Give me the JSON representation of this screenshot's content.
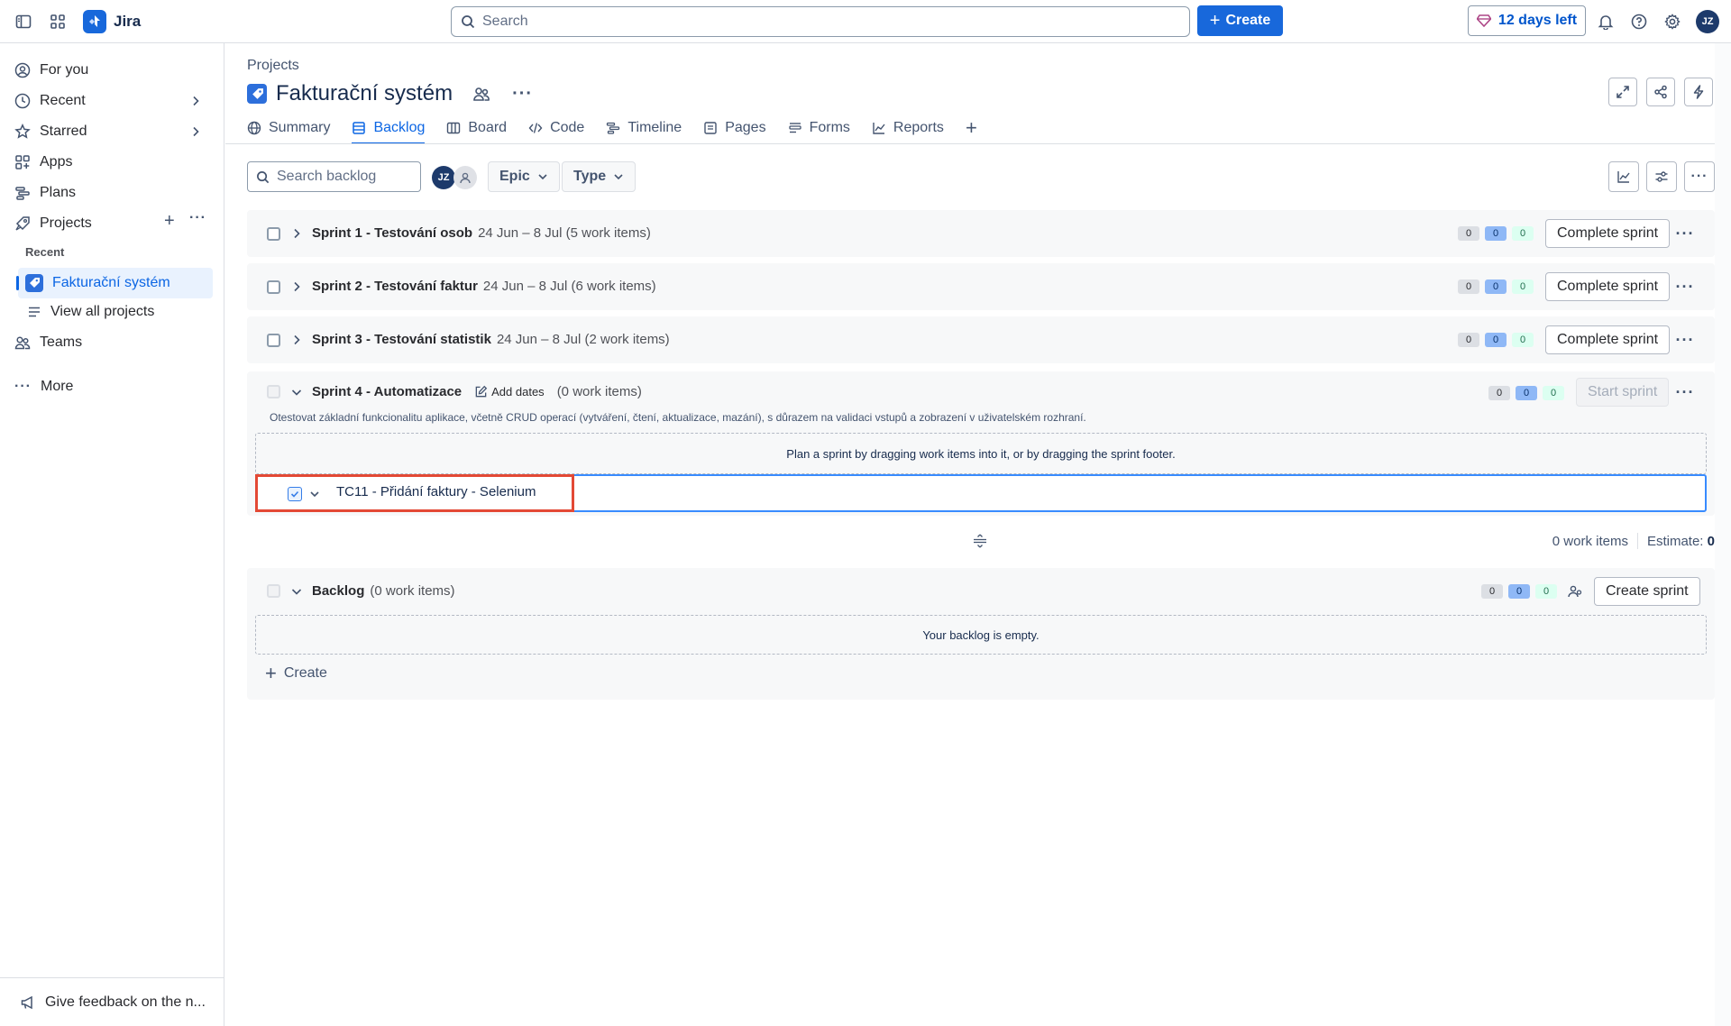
{
  "topbar": {
    "app_name": "Jira",
    "search_placeholder": "Search",
    "create_label": "Create",
    "trial_label": "12 days left",
    "user_initials": "JZ"
  },
  "sidebar": {
    "items": [
      {
        "label": "For you"
      },
      {
        "label": "Recent"
      },
      {
        "label": "Starred"
      },
      {
        "label": "Apps"
      },
      {
        "label": "Plans"
      },
      {
        "label": "Projects"
      }
    ],
    "recent_heading": "Recent",
    "active_project": "Fakturační systém",
    "view_all": "View all projects",
    "teams": "Teams",
    "more": "More",
    "feedback": "Give feedback on the n..."
  },
  "header": {
    "breadcrumb": "Projects",
    "project_title": "Fakturační systém"
  },
  "tabs": [
    {
      "label": "Summary"
    },
    {
      "label": "Backlog"
    },
    {
      "label": "Board"
    },
    {
      "label": "Code"
    },
    {
      "label": "Timeline"
    },
    {
      "label": "Pages"
    },
    {
      "label": "Forms"
    },
    {
      "label": "Reports"
    }
  ],
  "toolbar": {
    "search_placeholder": "Search backlog",
    "avatar_initials": "JZ",
    "epic_label": "Epic",
    "type_label": "Type"
  },
  "sprints": [
    {
      "name": "Sprint 1 - Testování osob",
      "meta": "24 Jun – 8 Jul (5 work items)",
      "counts": [
        "0",
        "0",
        "0"
      ],
      "action": "Complete sprint"
    },
    {
      "name": "Sprint 2 - Testování faktur",
      "meta": "24 Jun – 8 Jul (6 work items)",
      "counts": [
        "0",
        "0",
        "0"
      ],
      "action": "Complete sprint"
    },
    {
      "name": "Sprint 3 - Testování statistik",
      "meta": "24 Jun – 8 Jul (2 work items)",
      "counts": [
        "0",
        "0",
        "0"
      ],
      "action": "Complete sprint"
    }
  ],
  "sprint4": {
    "name": "Sprint 4 - Automatizace",
    "add_dates": "Add dates",
    "meta": "(0 work items)",
    "counts": [
      "0",
      "0",
      "0"
    ],
    "action": "Start sprint",
    "goal": "Otestovat základní funkcionalitu aplikace, včetně CRUD operací (vytváření, čtení, aktualizace, mazání), s důrazem na validaci vstupů a zobrazení v uživatelském rozhraní.",
    "drop_hint": "Plan a sprint by dragging work items into it, or by dragging the sprint footer.",
    "new_item_value": "TC11 - Přidání faktury - Selenium",
    "work_items": "0 work items",
    "estimate_label": "Estimate:",
    "estimate_value": "0"
  },
  "backlog": {
    "name": "Backlog",
    "meta": "(0 work items)",
    "counts": [
      "0",
      "0",
      "0"
    ],
    "action": "Create sprint",
    "empty": "Your backlog is empty.",
    "create_label": "Create"
  },
  "colors": {
    "accent": "#1868db",
    "highlight_red": "#e34935",
    "focus_blue": "#388bff"
  }
}
